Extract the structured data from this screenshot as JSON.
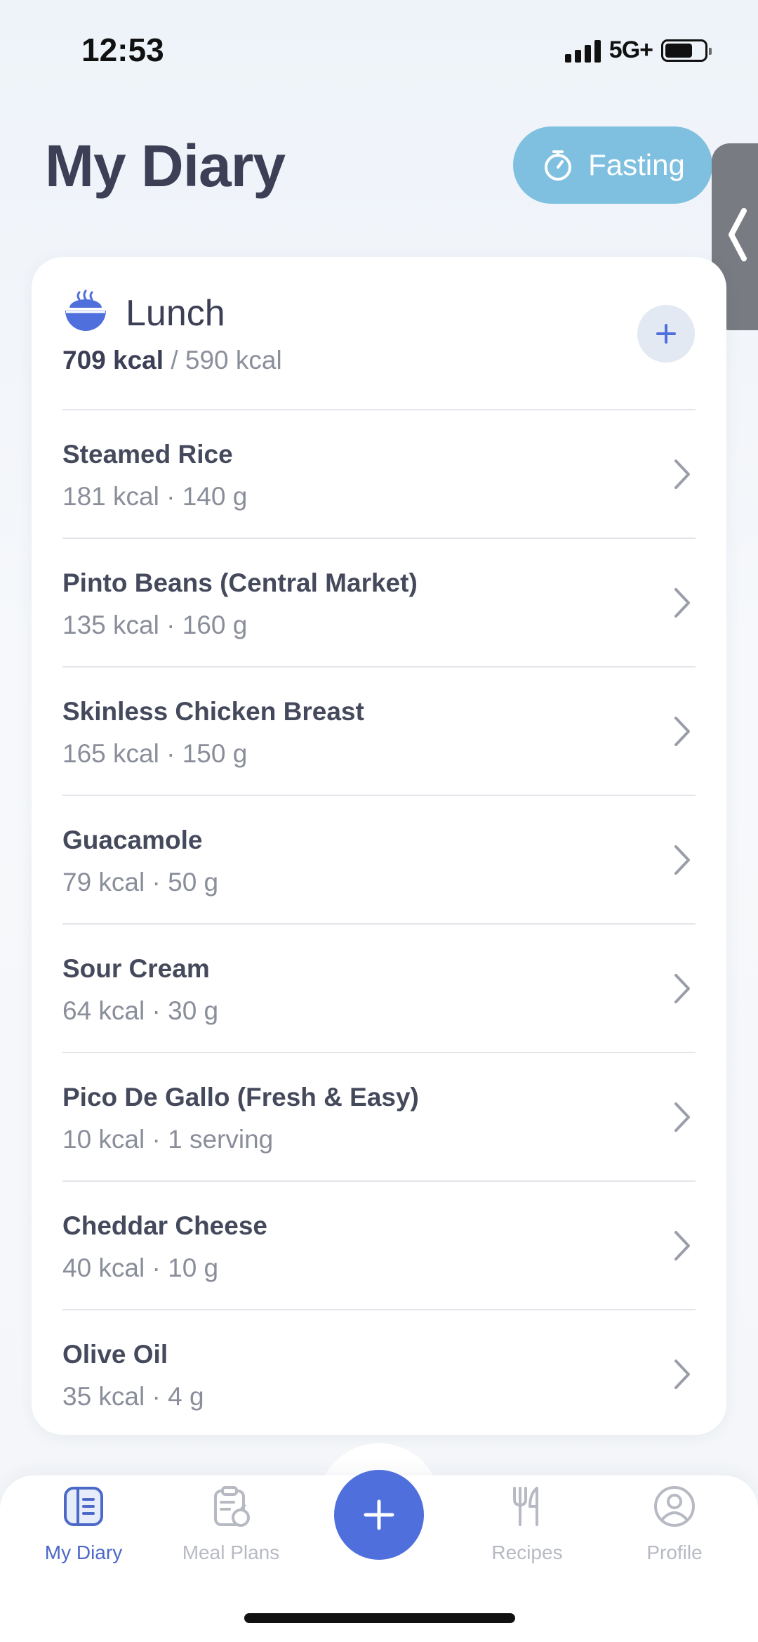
{
  "status_bar": {
    "time": "12:53",
    "network": "5G+",
    "battery_level": 0.7
  },
  "header": {
    "title": "My Diary",
    "fasting_label": "Fasting",
    "fasting_color": "#7fc0e0"
  },
  "meal": {
    "name": "Lunch",
    "kcal_consumed": "709 kcal",
    "kcal_goal": "/ 590 kcal",
    "icon": "bowl-icon",
    "items": [
      {
        "name": "Steamed Rice",
        "meta": "181 kcal · 140 g"
      },
      {
        "name": "Pinto Beans (Central Market)",
        "meta": "135 kcal · 160 g"
      },
      {
        "name": "Skinless Chicken Breast",
        "meta": "165 kcal · 150 g"
      },
      {
        "name": "Guacamole",
        "meta": "79 kcal · 50 g"
      },
      {
        "name": "Sour Cream",
        "meta": "64 kcal · 30 g"
      },
      {
        "name": "Pico De Gallo (Fresh & Easy)",
        "meta": "10 kcal · 1 serving"
      },
      {
        "name": "Cheddar Cheese",
        "meta": "40 kcal · 10 g"
      },
      {
        "name": "Olive Oil",
        "meta": "35 kcal · 4 g"
      }
    ]
  },
  "nav": {
    "my_diary": "My Diary",
    "meal_plans": "Meal Plans",
    "recipes": "Recipes",
    "profile": "Profile",
    "active": "my_diary",
    "accent": "#4f6fdc"
  }
}
